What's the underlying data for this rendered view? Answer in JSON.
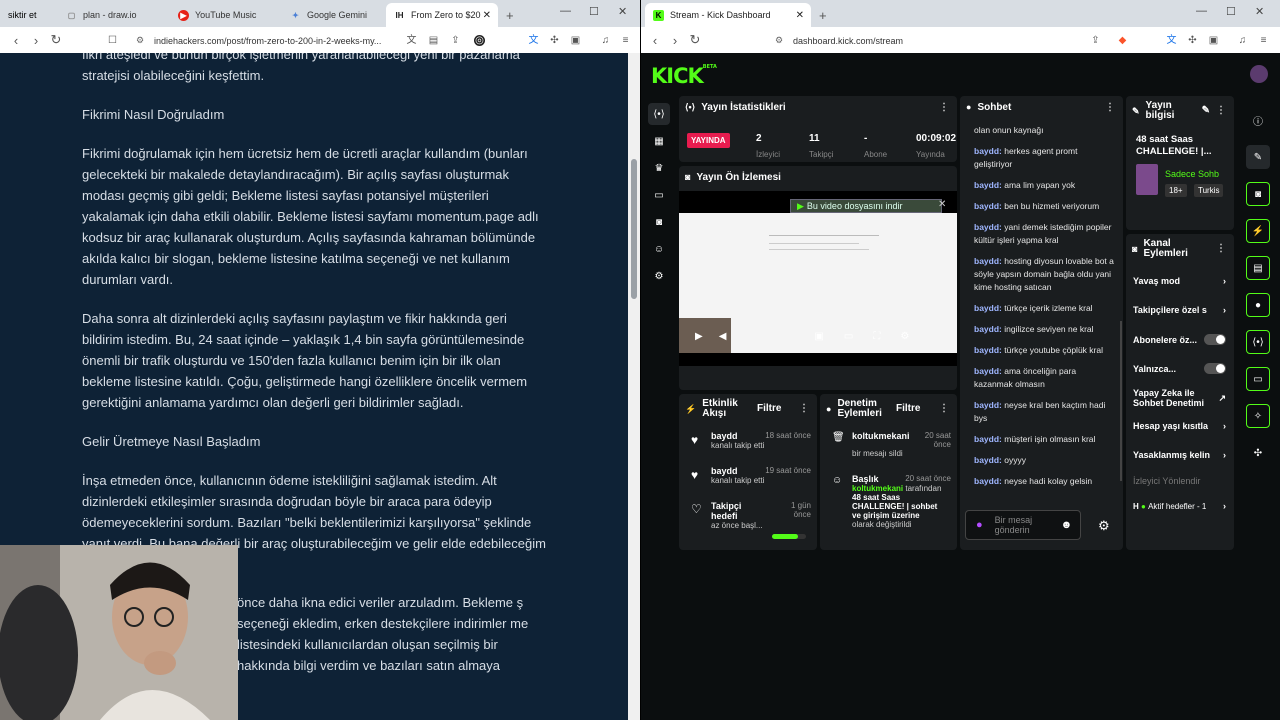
{
  "left_window": {
    "tabs": [
      {
        "label": "siktir et"
      },
      {
        "label": "plan - draw.io"
      },
      {
        "label": "YouTube Music"
      },
      {
        "label": "Google Gemini"
      },
      {
        "label": "From Zero to $20"
      }
    ],
    "url": "indiehackers.com/post/from-zero-to-200-in-2-weeks-my...",
    "article": {
      "p0": "fikri ateşledi ve bunun birçok işletmenin yararlanabileceği yeni bir pazarlama stratejisi olabileceğini keşfettim.",
      "h1": "Fikrimi Nasıl Doğruladım",
      "p1": "Fikrimi doğrulamak için hem ücretsiz hem de ücretli araçlar kullandım (bunları gelecekteki bir makalede detaylandıracağım). Bir açılış sayfası oluşturmak modası geçmiş gibi geldi; Bekleme listesi sayfası potansiyel müşterileri yakalamak için daha etkili olabilir. Bekleme listesi sayfamı momentum.page adlı kodsuz bir araç kullanarak oluşturdum. Açılış sayfasında kahraman bölümünde akılda kalıcı bir slogan, bekleme listesine katılma seçeneği ve net kullanım durumları vardı.",
      "p2": "Daha sonra alt dizinlerdeki açılış sayfasını paylaştım ve fikir hakkında geri bildirim istedim. Bu, 24 saat içinde – yaklaşık 1,4 bin sayfa görüntülemesinde önemli bir trafik oluşturdu ve 150'den fazla kullanıcı benim için bir ilk olan bekleme listesine katıldı. Çoğu, geliştirmede hangi özelliklere öncelik vermem gerektiğini anlamama yardımcı olan değerli geri bildirimler sağladı.",
      "h2": "Gelir Üretmeye Nasıl Başladım",
      "p3": "İnşa etmeden önce, kullanıcının ödeme istekliliğini sağlamak istedim. Alt dizinlerdeki etkileşimler sırasında doğrudan böyle bir araca para ödeyip ödemeyeceklerini sordum. Bazıları \"belki beklentilerimizi karşılıyorsa\" şeklinde yanıt verdi. Bu bana değerli bir araç oluşturabileceğim ve gelir elde edebileceğim",
      "p4": "önce daha ikna edici veriler arzuladım. Bekleme ş seçeneği ekledim, erken destekçilere indirimler me listesindeki kullanıcılardan oluşan seçilmiş bir hakkında bilgi verdim ve bazıları satın almaya"
    }
  },
  "right_window": {
    "tabs": [
      {
        "label": "Stream - Kick Dashboard"
      }
    ],
    "url": "dashboard.kick.com/stream",
    "logo": "KICK",
    "logo_sup": "BETA",
    "stats": {
      "title": "Yayın İstatistikleri",
      "live_label": "YAYINDA",
      "viewers": "2",
      "viewers_label": "İzleyici",
      "followers": "11",
      "followers_label": "Takipçi",
      "subs": "-",
      "subs_label": "Abone",
      "duration": "00:09:02",
      "duration_label": "Yayında"
    },
    "preview": {
      "title": "Yayın Ön İzlemesi",
      "pip_label": "Bu video dosyasını indir"
    },
    "chat": {
      "title": "Sohbet",
      "input_placeholder": "Bir mesaj gönderin",
      "messages": [
        {
          "user": "",
          "text": "olan onun kaynağı"
        },
        {
          "user": "baydd:",
          "text": " herkes agent promt geliştiriyor"
        },
        {
          "user": "baydd:",
          "text": " ama lim yapan yok"
        },
        {
          "user": "baydd:",
          "text": " ben bu hizmeti veriyorum"
        },
        {
          "user": "baydd:",
          "text": " yani demek istediğim popiler kültür işleri yapma kral"
        },
        {
          "user": "baydd:",
          "text": " hosting diyosun lovable bot a söyle yapsın domain bağla oldu yani kime hosting satıcan"
        },
        {
          "user": "baydd:",
          "text": " türkçe içerik izleme kral"
        },
        {
          "user": "baydd:",
          "text": " ingilizce seviyen ne kral"
        },
        {
          "user": "baydd:",
          "text": " türkçe youtube çöplük kral"
        },
        {
          "user": "baydd:",
          "text": " ama önceliğin para kazanmak olmasın"
        },
        {
          "user": "baydd:",
          "text": " neyse kral ben kaçtım hadi bys"
        },
        {
          "user": "baydd:",
          "text": " müşteri işin olmasın kral"
        },
        {
          "user": "baydd:",
          "text": " oyyyy"
        },
        {
          "user": "baydd:",
          "text": " neyse hadi kolay gelsin"
        }
      ]
    },
    "stream_info": {
      "title": "Yayın bilgisi",
      "stream_title": "48 saat Saas CHALLENGE! |...",
      "category": "Sadece Sohb",
      "age": "18+",
      "lang": "Turkis"
    },
    "channel_actions": {
      "title": "Kanal Eylemleri",
      "items": [
        {
          "label": "Yavaş mod"
        },
        {
          "label": "Takipçilere özel s"
        },
        {
          "label": "Abonelere öz..."
        },
        {
          "label": "Yalnızca..."
        },
        {
          "label": "Yapay Zeka ile Sohbet Denetimi"
        },
        {
          "label": "Hesap yaşı kısıtla"
        },
        {
          "label": "Yasaklanmış kelin"
        },
        {
          "label": "İzleyici Yönlendir"
        },
        {
          "label": "Aktif hedefler - 1"
        }
      ]
    },
    "activity": {
      "title": "Etkinlik Akışı",
      "filter": "Filtre",
      "events": [
        {
          "name": "baydd",
          "sub": "kanalı takip etti",
          "time": "18 saat önce"
        },
        {
          "name": "baydd",
          "sub": "kanalı takip etti",
          "time": "19 saat önce"
        },
        {
          "name": "Takipçi hedefi",
          "sub": "az önce başl...",
          "time": "1 gün önce"
        }
      ],
      "goal_progress": 0.75
    },
    "moderation": {
      "title": "Denetim Eylemleri",
      "filter": "Filtre",
      "events": [
        {
          "name": "koltukmekani",
          "sub": "bir mesajı sildi",
          "time": "20 saat önce"
        },
        {
          "name": "Başlık",
          "sub_user": "koltukmekani",
          "sub_mid": " tarafından ",
          "sub_title": "48 saat Saas CHALLENGE! | sohbet ve girişim üzerine",
          "sub_tail": " olarak değiştirildi",
          "time": "20 saat önce"
        }
      ]
    }
  }
}
